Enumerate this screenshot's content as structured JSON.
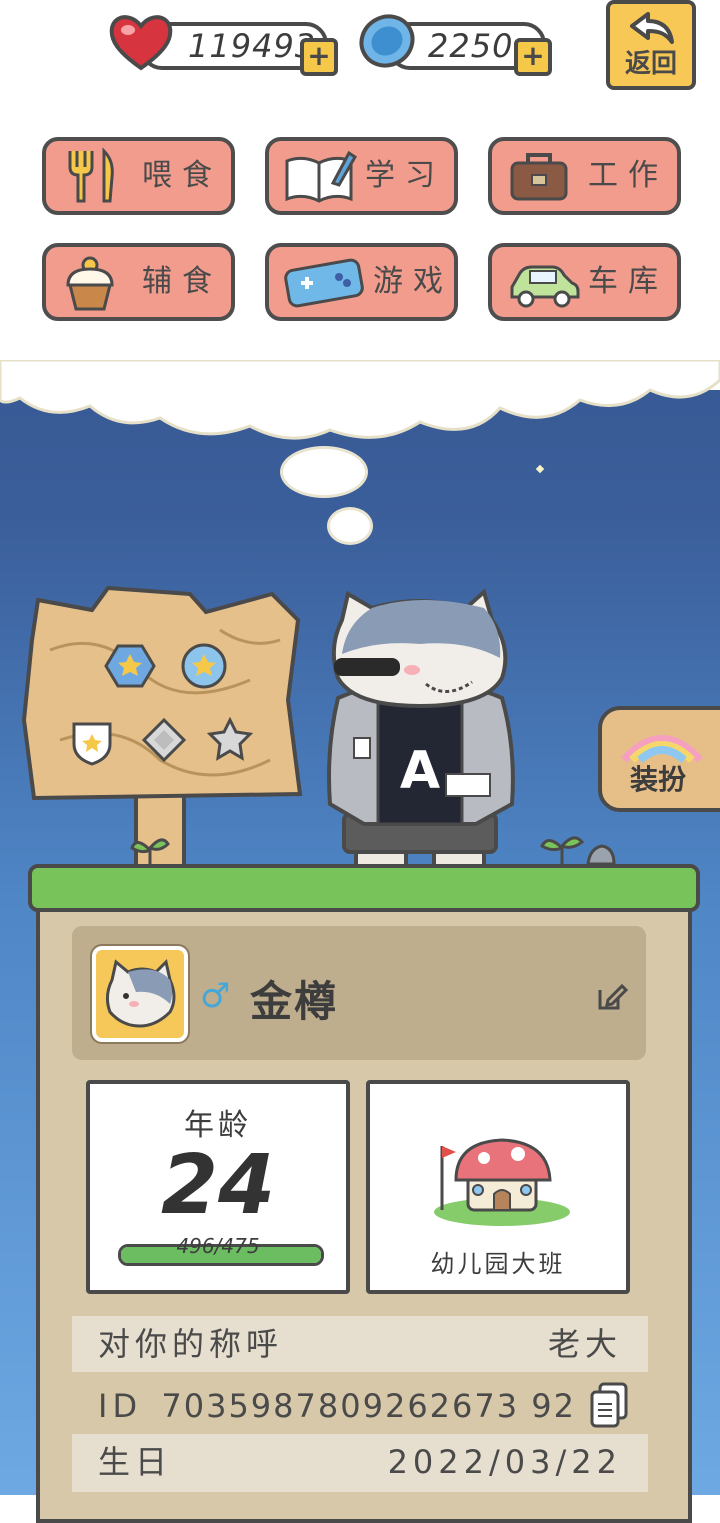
{
  "currency": {
    "hearts": "119493",
    "coins": "2250"
  },
  "back_label": "返回",
  "actions": [
    {
      "label": "喂食",
      "icon": "fork-knife-icon"
    },
    {
      "label": "学习",
      "icon": "book-pen-icon"
    },
    {
      "label": "工作",
      "icon": "briefcase-icon"
    },
    {
      "label": "辅食",
      "icon": "cupcake-icon"
    },
    {
      "label": "游戏",
      "icon": "gamepad-icon"
    },
    {
      "label": "车库",
      "icon": "car-icon"
    }
  ],
  "dress_label": "装扮",
  "pet": {
    "gender_symbol": "♂",
    "name": "金樽",
    "age_label": "年龄",
    "age": "24",
    "age_exp": "496/475",
    "age_progress": 1.0,
    "school": "幼儿园大班"
  },
  "info": {
    "nickname_label": "对你的称呼",
    "nickname_value": "老大",
    "id_label": "ID",
    "id_value": "7035987809262673 92",
    "birthday_label": "生日",
    "birthday_value": "2022/03/22"
  },
  "colors": {
    "button": "#f29c8d",
    "panel": "#d7c8aa",
    "grass": "#78c35a"
  }
}
